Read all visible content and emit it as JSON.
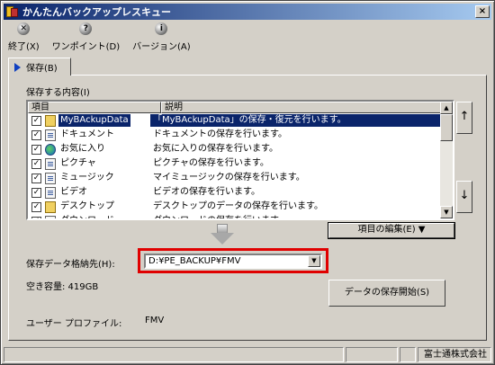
{
  "window": {
    "title": "かんたんバックアップレスキュー",
    "close_glyph": "×"
  },
  "toolbar": [
    {
      "label": "終了(X)",
      "icon": "close-circle-icon",
      "glyph": "✕"
    },
    {
      "label": "ワンポイント(D)",
      "icon": "help-circle-icon",
      "glyph": "?"
    },
    {
      "label": "バージョン(A)",
      "icon": "info-circle-icon",
      "glyph": "i"
    }
  ],
  "tab": {
    "label": "保存(B)"
  },
  "section": {
    "label": "保存する内容(I)"
  },
  "list": {
    "columns": [
      "項目",
      "説明"
    ],
    "rows": [
      {
        "name": "MyBAckupData",
        "desc": "「MyBAckupData」の保存・復元を行います。",
        "checked": true,
        "selected": true,
        "icon": "backup-data-icon"
      },
      {
        "name": "ドキュメント",
        "desc": "ドキュメントの保存を行います。",
        "checked": true,
        "selected": false,
        "icon": "document-icon"
      },
      {
        "name": "お気に入り",
        "desc": "お気に入りの保存を行います。",
        "checked": true,
        "selected": false,
        "icon": "favorites-globe-icon"
      },
      {
        "name": "ピクチャ",
        "desc": "ピクチャの保存を行います。",
        "checked": true,
        "selected": false,
        "icon": "document-icon"
      },
      {
        "name": "ミュージック",
        "desc": "マイミュージックの保存を行います。",
        "checked": true,
        "selected": false,
        "icon": "document-icon"
      },
      {
        "name": "ビデオ",
        "desc": "ビデオの保存を行います。",
        "checked": true,
        "selected": false,
        "icon": "document-icon"
      },
      {
        "name": "デスクトップ",
        "desc": "デスクトップのデータの保存を行います。",
        "checked": true,
        "selected": false,
        "icon": "desktop-folder-icon"
      },
      {
        "name": "ダウンロード",
        "desc": "ダウンロードの保存を行います。",
        "checked": true,
        "selected": false,
        "icon": "document-icon"
      }
    ],
    "check_glyph": "✓"
  },
  "move_up_glyph": "↑",
  "move_down_glyph": "↓",
  "edit_button": {
    "label": "項目の編集(E) ▼"
  },
  "destination": {
    "label": "保存データ格納先(H):",
    "value": "D:¥PE_BACKUP¥FMV"
  },
  "free_space": {
    "label": "空き容量: 419GB"
  },
  "start_button": {
    "label": "データの保存開始(S)"
  },
  "profile": {
    "label": "ユーザー プロファイル:",
    "value": "FMV"
  },
  "status": {
    "company": "富士通株式会社"
  },
  "colors": {
    "selection": "#0a246a",
    "highlight_frame": "#e00000",
    "title_gradient_start": "#0a246a"
  }
}
